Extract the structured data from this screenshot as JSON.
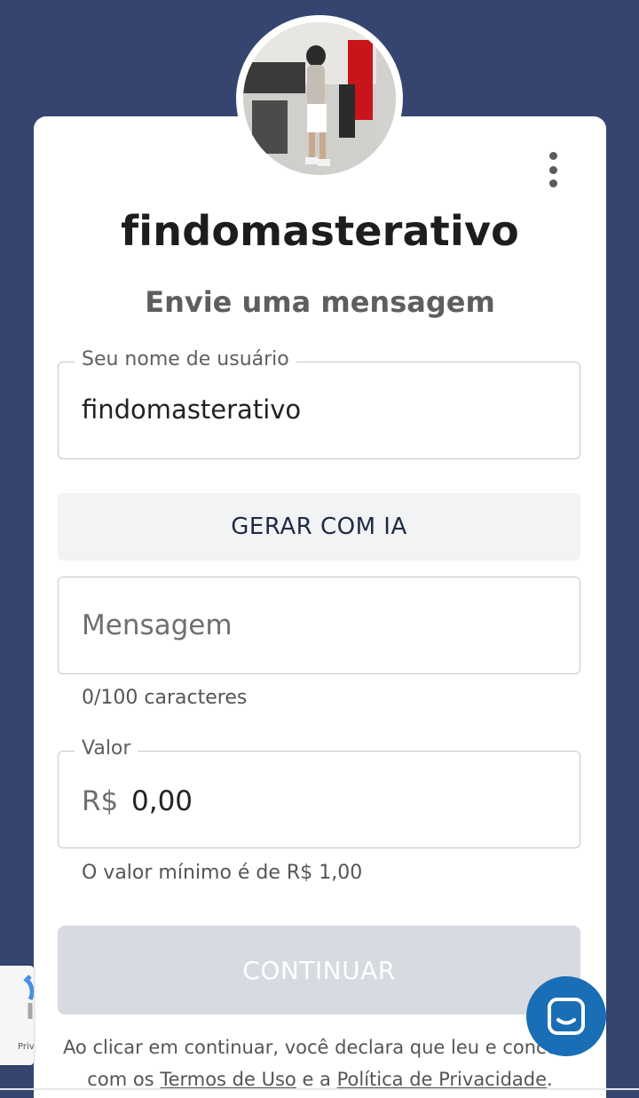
{
  "profile": {
    "username": "findomasterativo",
    "subtitle": "Envie uma mensagem",
    "avatar_icon": "profile-photo"
  },
  "form": {
    "username_field": {
      "label": "Seu nome de usuário",
      "value": "findomasterativo"
    },
    "ai_button_label": "GERAR COM IA",
    "message_field": {
      "placeholder": "Mensagem",
      "counter": "0/100 caracteres"
    },
    "value_field": {
      "label": "Valor",
      "currency": "R$",
      "value": "0,00",
      "hint": "O valor mínimo é de R$ 1,00"
    },
    "continue_label": "CONTINUAR"
  },
  "legal": {
    "prefix": "Ao clicar em continuar, você declara que leu e concord",
    "line2_prefix": "com os",
    "terms_link": "Termos de Uso",
    "and": "e a",
    "privacy_link": "Política de Privacidade",
    "suffix": "."
  },
  "recaptcha": {
    "text": "Priva"
  },
  "icons": {
    "menu": "more-vertical-icon",
    "chat": "chat-icon"
  },
  "colors": {
    "background": "#364470",
    "card": "#ffffff",
    "chat_button": "#1a6eb5",
    "continue_disabled": "#d7dae0"
  }
}
